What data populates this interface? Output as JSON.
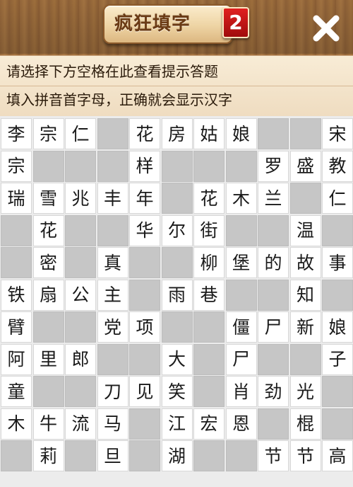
{
  "header": {
    "title": "疯狂填字",
    "badge": "2"
  },
  "hints": {
    "line1": "请选择下方空格在此查看提示答题",
    "line2": "填入拼音首字母，正确就会显示汉字"
  },
  "icons": {
    "close": "close-icon"
  },
  "colors": {
    "cell_filled": "#ffffff",
    "cell_empty": "#c6c6c6",
    "badge": "#d01818"
  },
  "grid": [
    [
      "李",
      "宗",
      "仁",
      "",
      "花",
      "房",
      "姑",
      "娘",
      "",
      "",
      "宋"
    ],
    [
      "宗",
      "",
      "",
      "",
      "样",
      "",
      "",
      "",
      "罗",
      "盛",
      "教"
    ],
    [
      "瑞",
      "雪",
      "兆",
      "丰",
      "年",
      "",
      "花",
      "木",
      "兰",
      "",
      "仁"
    ],
    [
      "",
      "花",
      "",
      "",
      "华",
      "尔",
      "街",
      "",
      "",
      "温",
      ""
    ],
    [
      "",
      "密",
      "",
      "真",
      "",
      "",
      "柳",
      "堡",
      "的",
      "故",
      "事"
    ],
    [
      "铁",
      "扇",
      "公",
      "主",
      "",
      "雨",
      "巷",
      "",
      "",
      "知",
      ""
    ],
    [
      "臂",
      "",
      "",
      "党",
      "项",
      "",
      "",
      "僵",
      "尸",
      "新",
      "娘"
    ],
    [
      "阿",
      "里",
      "郎",
      "",
      "",
      "大",
      "",
      "尸",
      "",
      "",
      "子"
    ],
    [
      "童",
      "",
      "",
      "刀",
      "见",
      "笑",
      "",
      "肖",
      "劲",
      "光",
      ""
    ],
    [
      "木",
      "牛",
      "流",
      "马",
      "",
      "江",
      "宏",
      "恩",
      "",
      "棍",
      ""
    ],
    [
      "",
      "莉",
      "",
      "旦",
      "",
      "湖",
      "",
      "",
      "节",
      "节",
      "高"
    ]
  ]
}
